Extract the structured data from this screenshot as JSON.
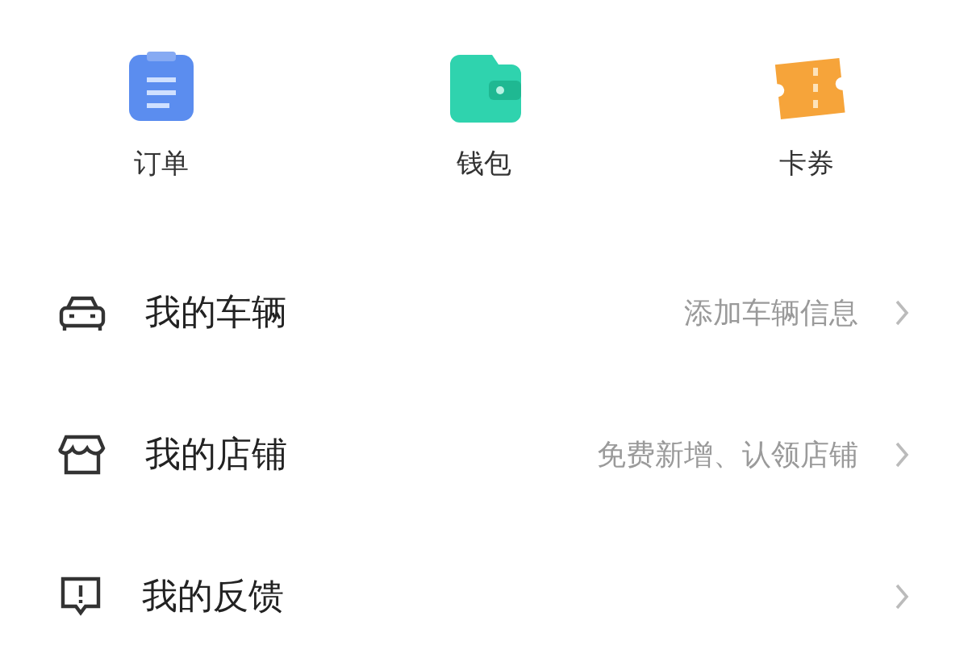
{
  "shortcuts": [
    {
      "kind": "order",
      "label": "订单"
    },
    {
      "kind": "wallet",
      "label": "钱包"
    },
    {
      "kind": "coupon",
      "label": "卡券"
    }
  ],
  "menu_items": [
    {
      "kind": "car",
      "title": "我的车辆",
      "hint": "添加车辆信息"
    },
    {
      "kind": "store",
      "title": "我的店铺",
      "hint": "免费新增、认领店铺"
    },
    {
      "kind": "feedback",
      "title": "我的反馈"
    }
  ]
}
